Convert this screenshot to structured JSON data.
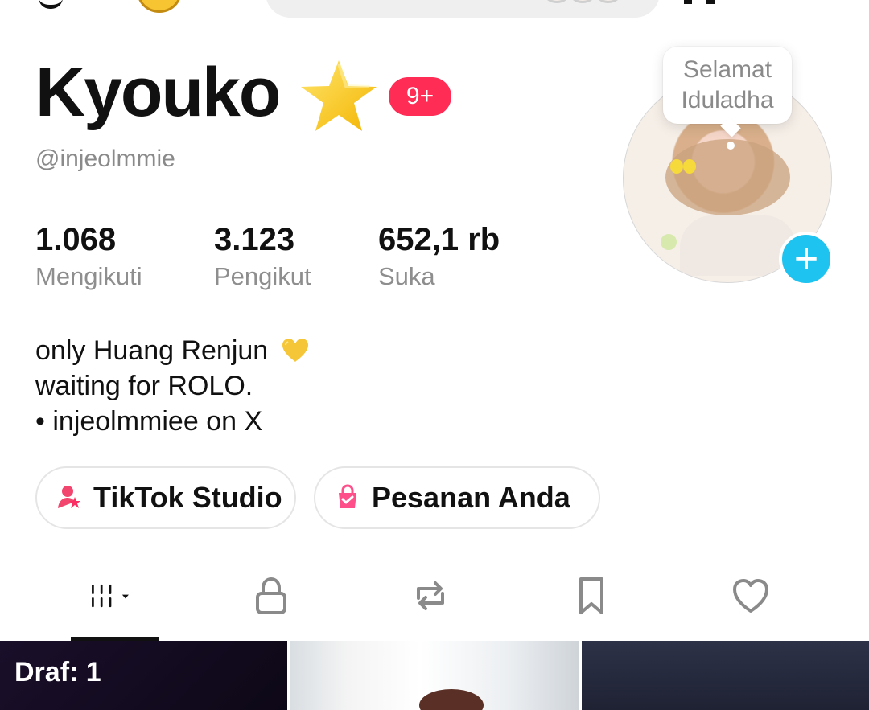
{
  "profile": {
    "name": "Kyouko",
    "badge": "9+",
    "handle": "@injeolmmie"
  },
  "stats": [
    {
      "value": "1.068",
      "label": "Mengikuti"
    },
    {
      "value": "3.123",
      "label": "Pengikut"
    },
    {
      "value": "652,1 rb",
      "label": "Suka"
    }
  ],
  "bubble": {
    "line1": "Selamat",
    "line2": "Iduladha"
  },
  "bio": {
    "line1": "only Huang Renjun",
    "line2": "waiting for ROLO.",
    "line3": "• injeolmmiee on X"
  },
  "buttons": {
    "studio": "TikTok Studio",
    "order": "Pesanan Anda"
  },
  "grid": {
    "draft_label": "Draf: 1"
  },
  "colors": {
    "badge": "#ff2c55",
    "plus": "#1fc3ef",
    "muted": "#8e8e8e",
    "underline": "#111111"
  },
  "icons": {
    "tabs": [
      "grid-icon",
      "lock-icon",
      "repost-icon",
      "bookmark-icon",
      "heart-icon"
    ],
    "studio": "studio-icon",
    "order": "shopping-bag-icon",
    "bio_emoji": "yellow-heart-icon"
  }
}
